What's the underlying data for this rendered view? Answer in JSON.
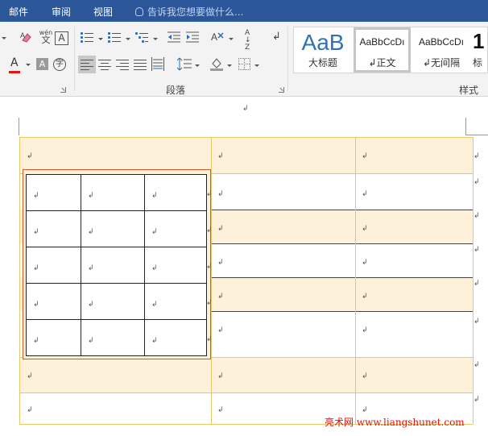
{
  "menu": {
    "tabs": [
      "邮件",
      "审阅",
      "视图"
    ],
    "tell_me": "告诉我您想要做什么..."
  },
  "ribbon": {
    "paragraph_group_label": "段落",
    "styles_group_label": "样式",
    "font_tools": {
      "wen_label": "wén",
      "wen_char": "文",
      "char_border": "A",
      "font_color": "A",
      "char_shading": "A",
      "enclose_char": "字"
    },
    "sort_label": "A↓Z",
    "styles": [
      {
        "preview": "AaB",
        "name": "大标题",
        "mark": ""
      },
      {
        "preview": "AaBbCcDı",
        "name": "正文",
        "mark": "↲"
      },
      {
        "preview": "AaBbCcDı",
        "name": "无间隔",
        "mark": "↲"
      },
      {
        "preview": "1",
        "name": "标",
        "mark": ""
      }
    ]
  },
  "document": {
    "paragraph_mark": "↲",
    "cell_mark": "↲",
    "outer_table": {
      "rows": 8,
      "columns": 3,
      "shaded_rows": [
        0,
        2,
        4,
        6
      ]
    },
    "nested_table": {
      "rows": 5,
      "columns": 3,
      "cells": [
        [
          "↲",
          "↲",
          "↲"
        ],
        [
          "↲",
          "↲",
          "↲"
        ],
        [
          "↲",
          "↲",
          "↲"
        ],
        [
          "↲",
          "↲",
          "↲"
        ],
        [
          "↲",
          "↲",
          "↲"
        ]
      ]
    }
  },
  "watermark": "亮术网 www.liangshunet.com",
  "colors": {
    "menubar": "#2b579a",
    "ribbon": "#f3f3f3",
    "shaded_row": "#fdf2d9",
    "table_border": "#e4c86a",
    "nested_frame": "#d9582a",
    "font_color_bar": "#e81010",
    "watermark": "#e01010"
  }
}
